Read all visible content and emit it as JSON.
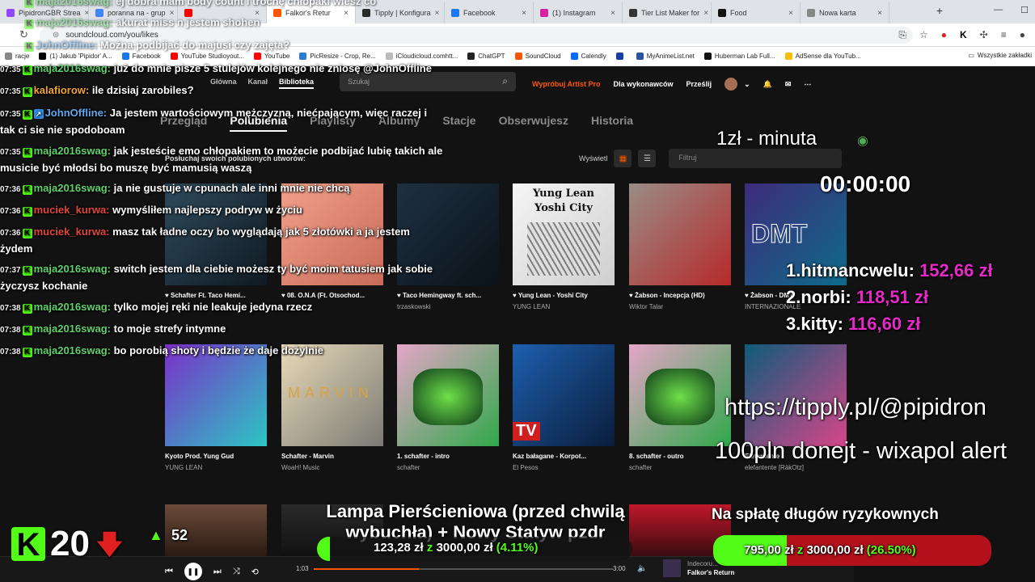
{
  "browser": {
    "tabs": [
      {
        "label": "PipidronGBR Strea",
        "fav": "#9146ff",
        "active": false
      },
      {
        "label": "poranna na - grup",
        "fav": "#4285f4",
        "active": false
      },
      {
        "label": "",
        "fav": "#ff0000",
        "active": false
      },
      {
        "label": "Falkor's Retur",
        "fav": "#ff5500",
        "active": true
      },
      {
        "label": "Tipply | Konfigura",
        "fav": "#2b2b2b",
        "active": false
      },
      {
        "label": "Facebook",
        "fav": "#1877f2",
        "active": false
      },
      {
        "label": "(1) Instagram",
        "fav": "#d6249f",
        "active": false
      },
      {
        "label": "Tier List Maker for",
        "fav": "#333333",
        "active": false
      },
      {
        "label": "Food",
        "fav": "#111111",
        "active": false
      },
      {
        "label": "Nowa karta",
        "fav": "#888888",
        "active": false
      }
    ],
    "url": "soundcloud.com/you/likes",
    "bookmarks": [
      {
        "label": "racje",
        "color": "#888888"
      },
      {
        "label": "(1) Jakub 'Pipidor' A...",
        "color": "#000000"
      },
      {
        "label": "Facebook",
        "color": "#1877f2"
      },
      {
        "label": "YouTube Studioyout...",
        "color": "#ff0000"
      },
      {
        "label": "YouTube",
        "color": "#ff0000"
      },
      {
        "label": "PicResize - Crop, Re...",
        "color": "#2a7bd1"
      },
      {
        "label": "iCloudicloud.comhtt...",
        "color": "#bbbbbb"
      },
      {
        "label": "ChatGPT",
        "color": "#222222"
      },
      {
        "label": "SoundCloud",
        "color": "#ff5500"
      },
      {
        "label": "Calendly",
        "color": "#006bff"
      },
      {
        "label": "",
        "color": "#1a3ca8"
      },
      {
        "label": "MyAnimeList.net",
        "color": "#2e51a2"
      },
      {
        "label": "Huberman Lab Full...",
        "color": "#111111"
      },
      {
        "label": "AdSense dla YouTub...",
        "color": "#fbbc04"
      }
    ],
    "bookmarks_all": "Wszystkie zakładki"
  },
  "sc": {
    "nav": [
      "Główna",
      "Kanał",
      "Biblioteka"
    ],
    "search_placeholder": "Szukaj",
    "try_pro": "Wypróbuj Artist Pro",
    "for_artists": "Dla wykonawców",
    "upload": "Prześlij",
    "subtabs": [
      "Przegląd",
      "Polubienia",
      "Playlisty",
      "Albumy",
      "Stacje",
      "Obserwujesz",
      "Historia"
    ],
    "listen_title": "Posłuchaj swoich polubionych utworów:",
    "view_label": "Wyświetl",
    "filter_placeholder": "Filtruj",
    "tracks": [
      {
        "title": "Schafter Ft. Taco Hemi...",
        "artist": "",
        "c1": "#2e4a5c",
        "c2": "#101a22"
      },
      {
        "title": "08. O.N.A (Ft. Otsochod...",
        "artist": "",
        "c1": "#f0a08c",
        "c2": "#c96b58"
      },
      {
        "title": "Taco Hemingway ft. sch...",
        "artist": "trzaskowski",
        "c1": "#1d3142",
        "c2": "#0b1219"
      },
      {
        "title": "Yung Lean - Yoshi City",
        "artist": "YUNG LEAN",
        "c1": "#f5f5f5",
        "c2": "#cfcfcf"
      },
      {
        "title": "Żabson - Incepcja (HD)",
        "artist": "Wiktor Talar",
        "c1": "#9a8c86",
        "c2": "#b52a2a"
      },
      {
        "title": "Żabson - DMT",
        "artist": "INTERNAZIONALE",
        "c1": "#3e2b7a",
        "c2": "#0e6b8a"
      },
      {
        "title": "Kyoto Prod. Yung Gud",
        "artist": "YUNG LEAN",
        "c1": "#7b2fc9",
        "c2": "#2bc6c4"
      },
      {
        "title": "Schafter - Marvin",
        "artist": "WoaH! Music",
        "c1": "#e8d9b8",
        "c2": "#7a7a74"
      },
      {
        "title": "1. schafter - intro",
        "artist": "schafter",
        "c1": "#e5a6c8",
        "c2": "#2fa84a"
      },
      {
        "title": "Kaz bałagane - Korpot...",
        "artist": "El Pesos",
        "c1": "#1d5fae",
        "c2": "#0a1d3c"
      },
      {
        "title": "8. schafter - outro",
        "artist": "schafter",
        "c1": "#e5a6c8",
        "c2": "#2fa84a"
      },
      {
        "title": "Elefantente",
        "artist": "elefantente [RäkOtz]",
        "c1": "#0d5b7a",
        "c2": "#d8468a"
      }
    ],
    "yoshi_text": [
      "Yung Lean",
      "Yoshi City"
    ],
    "dmt_text": "DMT",
    "marvin_text": "MARVIN",
    "tv_text": "TV",
    "player": {
      "current": "1:03",
      "duration": "3:00",
      "artist": "Indecoru...",
      "track": "Falkor's Return",
      "progress": 0.35
    }
  },
  "chat": [
    {
      "time": "07:35",
      "user": "maja2016swag:",
      "color": "g",
      "badge": "k",
      "msg": "już do mnie pisze 5 stulejów kolejnego nie zniosę @JohnOffline"
    },
    {
      "time": "07:35",
      "user": "kalafiorow:",
      "color": "y",
      "badge": "k",
      "msg": "ile dzisiaj zarobiles?"
    },
    {
      "time": "07:35",
      "user": "JohnOffline:",
      "color": "b",
      "badge": "kb",
      "msg": "Ja jestem wartościowym mężczyzną, niećpającym, więc raczej i"
    },
    {
      "time": "",
      "user": "",
      "color": "w",
      "badge": "",
      "msg": "tak ci sie nie spodoboam"
    },
    {
      "time": "07:35",
      "user": "maja2016swag:",
      "color": "g",
      "badge": "k",
      "msg": "jak jesteście emo chłopakiem to możecie podbijać lubię takich ale"
    },
    {
      "time": "",
      "user": "",
      "color": "w",
      "badge": "",
      "msg": "musicie być młodsi bo muszę być mamusią waszą"
    },
    {
      "time": "07:36",
      "user": "maja2016swag:",
      "color": "g",
      "badge": "k",
      "msg": "ja nie gustuje w cpunach ale inni mnie nie chcą"
    },
    {
      "time": "07:36",
      "user": "muciek_kurwa:",
      "color": "r",
      "badge": "k",
      "msg": "wymyśliłem najlepszy podryw w życiu"
    },
    {
      "time": "07:36",
      "user": "muciek_kurwa:",
      "color": "r",
      "badge": "k",
      "msg": "masz tak ładne oczy bo wyglądają jak 5 złotówki a ja jestem"
    },
    {
      "time": "",
      "user": "",
      "color": "w",
      "badge": "",
      "msg": "żydem"
    },
    {
      "time": "07:37",
      "user": "maja2016swag:",
      "color": "g",
      "badge": "k",
      "msg": "switch jestem dla ciebie możesz ty być moim tatusiem jak sobie"
    },
    {
      "time": "",
      "user": "",
      "color": "w",
      "badge": "",
      "msg": "życzysz kochanie"
    },
    {
      "time": "07:38",
      "user": "maja2016swag:",
      "color": "g",
      "badge": "k",
      "msg": "tylko mojej ręki nie leakuje jedyna rzecz"
    },
    {
      "time": "07:38",
      "user": "maja2016swag:",
      "color": "g",
      "badge": "k",
      "msg": "to moje strefy intymne"
    },
    {
      "time": "07:38",
      "user": "maja2016swag:",
      "color": "g",
      "badge": "k",
      "msg": "bo porobią shoty i będzie że daje dożylnie"
    }
  ],
  "chat_top": [
    {
      "user": "maja2016swag:",
      "msg": "ej dobra mam body count i trochę chłopaki wiesz co"
    },
    {
      "user": "maja2016swag:",
      "msg": "akurat miss n jestem shohen"
    },
    {
      "user": "JohnOffline:",
      "msg": "Można podbijać do majusi czy zajęta?"
    }
  ],
  "overlay": {
    "rate": "1zł - minuta",
    "timer": "00:00:00",
    "leaders": [
      {
        "rank": "1.",
        "name": "hitmancwelu:",
        "amount": "152,66 zł"
      },
      {
        "rank": "2.",
        "name": "norbi:",
        "amount": "118,51 zł"
      },
      {
        "rank": "3.",
        "name": "kitty:",
        "amount": "116,60 zł"
      }
    ],
    "tipply": "https://tipply.pl/@pipidron",
    "donate_alert": "100pln donejt - wixapol alert",
    "goal1": {
      "title": "Lampa Pierścieniowa (przed chwilą wybuchła) + Nowy Statyw pzdr",
      "current": "123,28 zł",
      "of": "z",
      "target": "3000,00 zł",
      "pct": "(4.11%)",
      "fraction": 0.0411,
      "color": "#53fc18"
    },
    "goal2": {
      "title": "Na spłatę długów ryzykownych",
      "current": "795,00 zł",
      "of": "z",
      "target": "3000,00 zł",
      "pct": "(26.50%)",
      "fraction": 0.265,
      "color": "#53fc18"
    },
    "kick_count": "20",
    "viewers_partial": "52"
  }
}
